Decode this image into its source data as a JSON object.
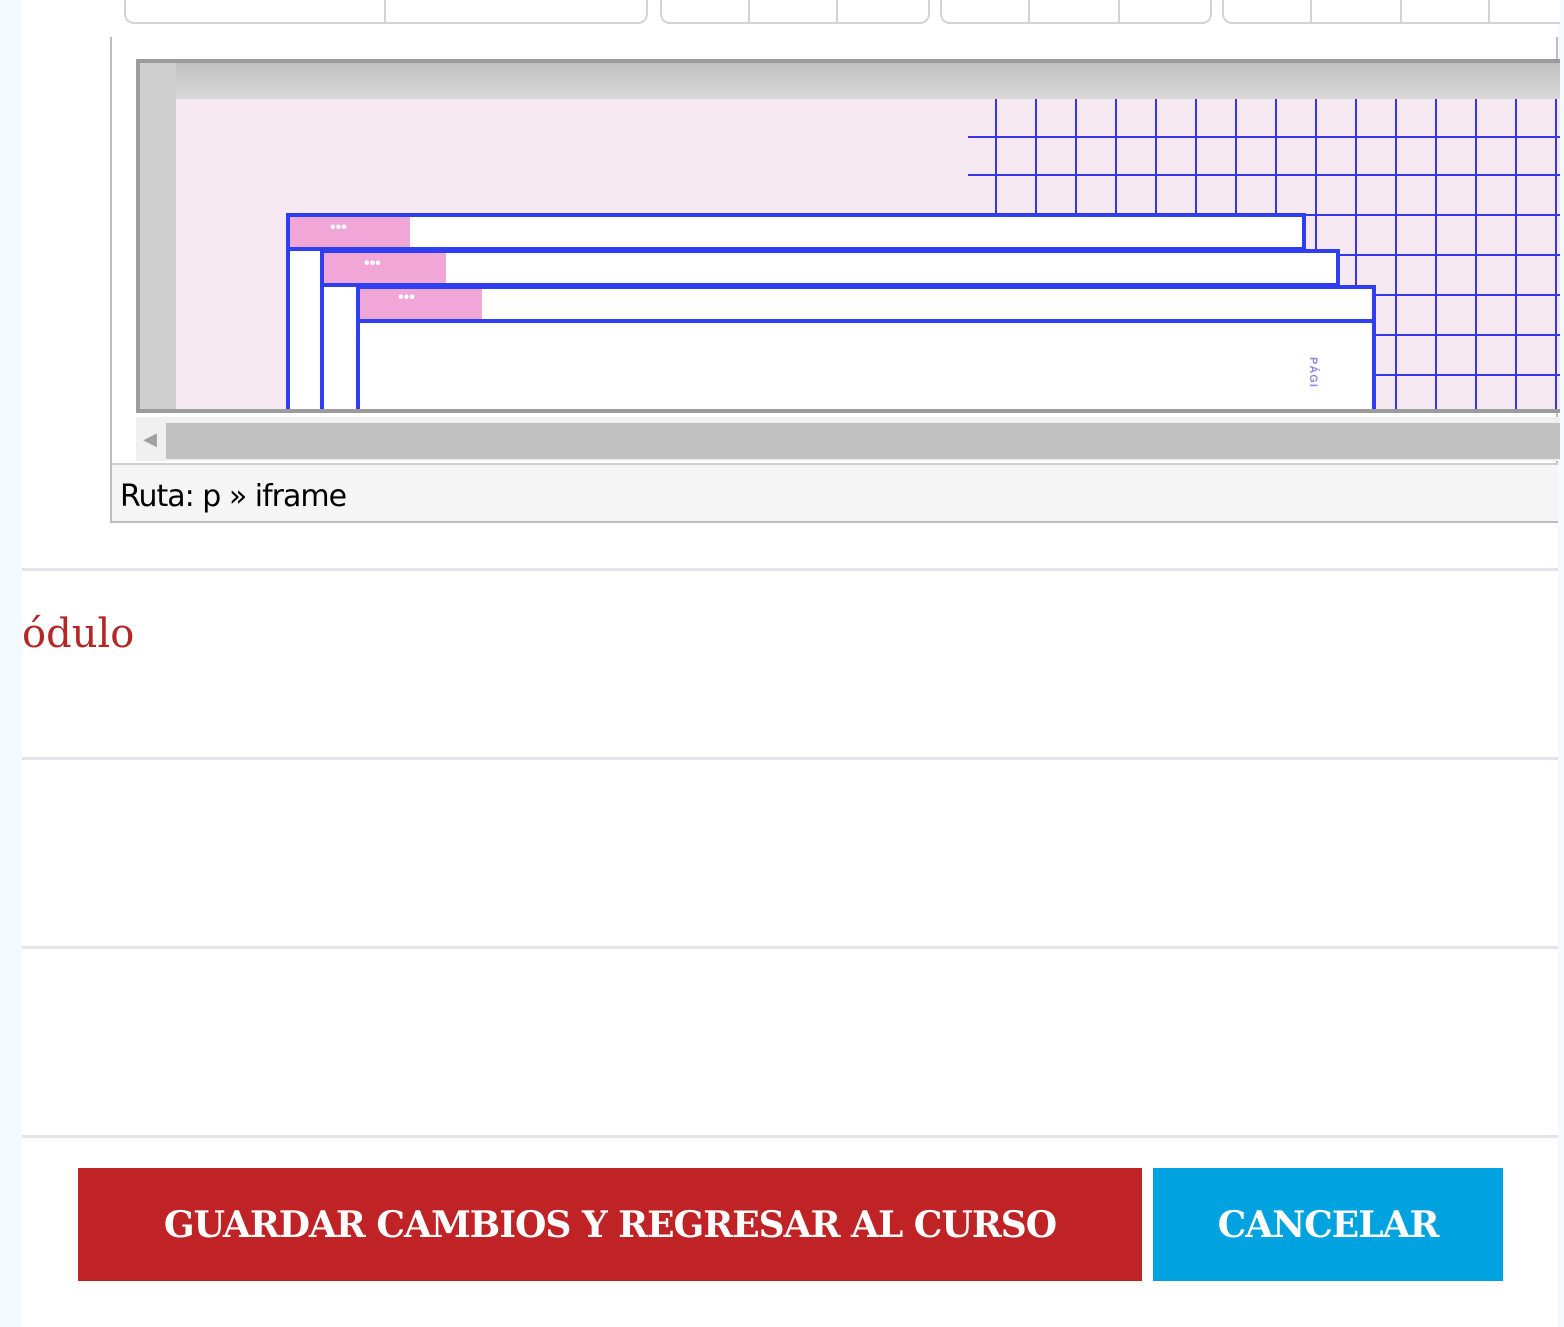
{
  "editor": {
    "statusbar_path": "Ruta: p » iframe",
    "iframe_window_badge": "•••",
    "iframe_vertical_text": "PÁGI"
  },
  "form": {
    "module_label": "ódulo"
  },
  "actions": {
    "save_label": "GUARDAR CAMBIOS Y REGRESAR AL CURSO",
    "cancel_label": "CANCELAR"
  },
  "colors": {
    "accent_red": "#c02326",
    "accent_blue": "#00a2e0",
    "grid_blue": "#3333ee",
    "window_pink": "#f0a6d6"
  }
}
